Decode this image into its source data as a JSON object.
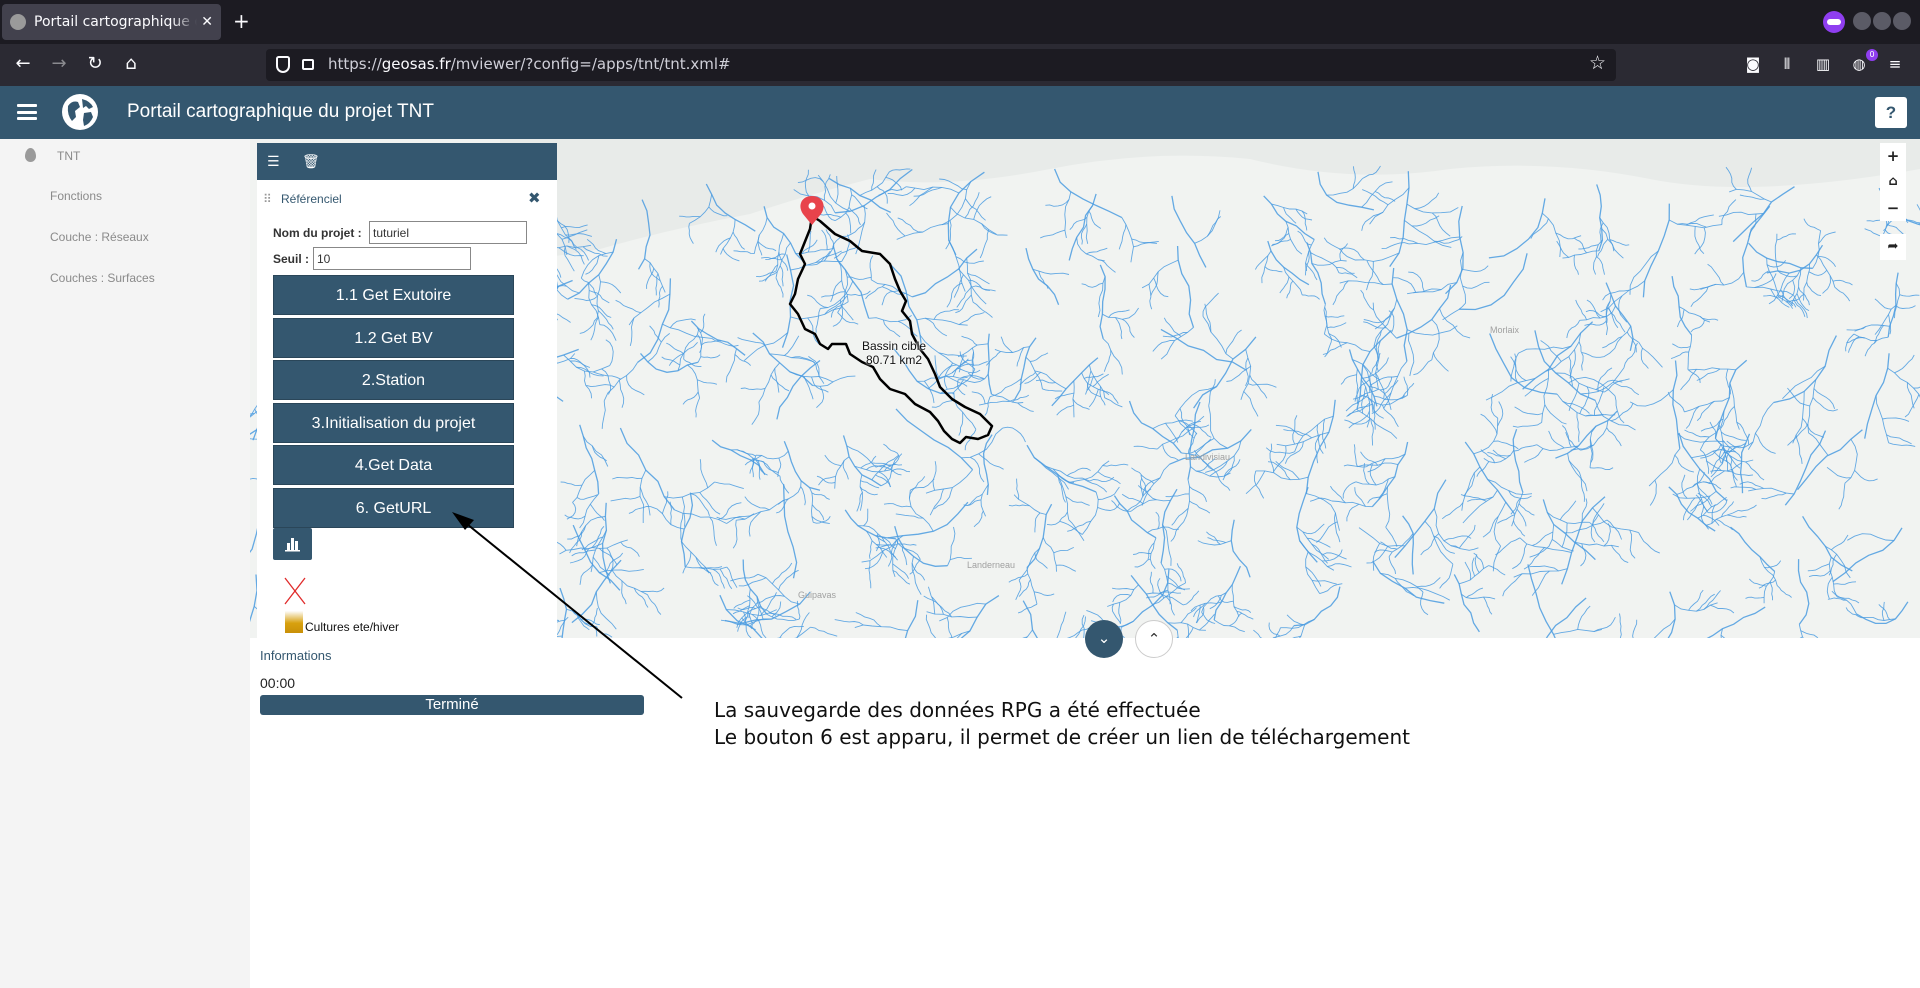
{
  "browser": {
    "tab_title": "Portail cartographique du projet TNT",
    "url_prefix": "https://",
    "url_host": "geosas.fr",
    "url_path": "/mviewer/?config=/apps/tnt/tnt.xml#",
    "extension_badge": "0"
  },
  "header": {
    "title": "Portail cartographique du projet TNT",
    "help_label": "?"
  },
  "sidebar": {
    "title": "TNT",
    "items": [
      {
        "label": "Fonctions"
      },
      {
        "label": "Couche : Réseaux"
      },
      {
        "label": "Couches : Surfaces"
      }
    ]
  },
  "panel": {
    "section_title": "Référenciel",
    "project_label": "Nom du projet :",
    "project_value": "tuturiel",
    "threshold_label": "Seuil :",
    "threshold_value": "10",
    "buttons": [
      {
        "label": "1.1 Get Exutoire"
      },
      {
        "label": "1.2 Get BV"
      },
      {
        "label": "2.Station"
      },
      {
        "label": "3.Initialisation du projet"
      },
      {
        "label": "4.Get Data"
      },
      {
        "label": "6. GetURL"
      }
    ],
    "legend_label": "Cultures ete/hiver"
  },
  "map": {
    "basin_label_line1": "Bassin cible",
    "basin_label_line2": "80.71 km2",
    "places": [
      "Morlaix",
      "Landivisiau",
      "Landerneau",
      "Guipavas"
    ],
    "river_color": "#4a9be0",
    "basin_outline_color": "#000000",
    "marker_color": "#e8434b"
  },
  "info": {
    "title": "Informations",
    "time": "00:00",
    "status": "Terminé",
    "progress": 100
  },
  "annotation": {
    "line1": "La sauvegarde des données RPG a été effectuée",
    "line2": "Le bouton 6 est apparu, il permet de créer un lien de téléchargement"
  },
  "theme": {
    "primary": "#34576f"
  }
}
